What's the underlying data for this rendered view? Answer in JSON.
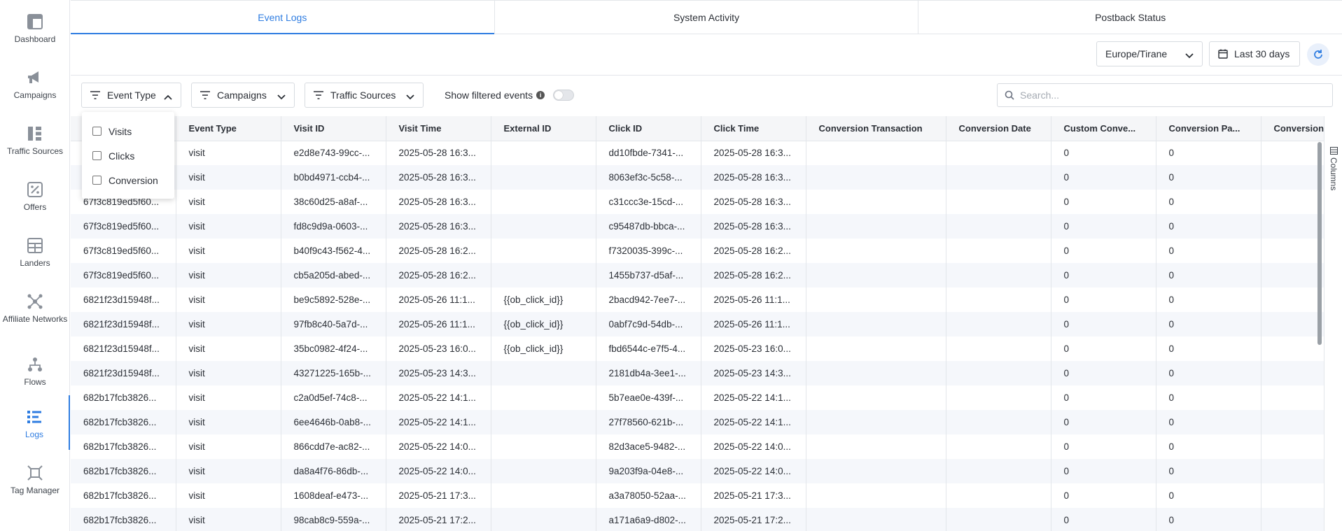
{
  "sidebar": {
    "items": [
      {
        "label": "Dashboard",
        "icon": "dashboard-icon"
      },
      {
        "label": "Campaigns",
        "icon": "megaphone-icon"
      },
      {
        "label": "Traffic Sources",
        "icon": "traffic-sources-icon"
      },
      {
        "label": "Offers",
        "icon": "percent-icon"
      },
      {
        "label": "Landers",
        "icon": "landers-icon"
      },
      {
        "label": "Affiliate Networks",
        "icon": "network-icon"
      },
      {
        "label": "Flows",
        "icon": "flows-icon"
      },
      {
        "label": "Logs",
        "icon": "logs-icon"
      },
      {
        "label": "Tag Manager",
        "icon": "tag-manager-icon"
      }
    ],
    "active": "Logs"
  },
  "tabs": [
    {
      "label": "Event Logs",
      "active": true
    },
    {
      "label": "System Activity",
      "active": false
    },
    {
      "label": "Postback Status",
      "active": false
    }
  ],
  "toolbar": {
    "timezone": "Europe/Tirane",
    "date_range": "Last 30 days"
  },
  "filters": {
    "event_type": "Event Type",
    "campaigns": "Campaigns",
    "traffic_sources": "Traffic Sources",
    "show_filtered": "Show filtered events",
    "search_placeholder": "Search..."
  },
  "dropdown": {
    "options": [
      "Visits",
      "Clicks",
      "Conversion"
    ]
  },
  "table": {
    "columns": [
      "",
      "Event Type",
      "Visit ID",
      "Visit Time",
      "External ID",
      "Click ID",
      "Click Time",
      "Conversion Transaction",
      "Conversion Date",
      "Custom Conve...",
      "Conversion Pa...",
      "Conversion"
    ],
    "rows": [
      [
        "",
        "visit",
        "e2d8e743-99cc-...",
        "2025-05-28 16:3...",
        "",
        "dd10fbde-7341-...",
        "2025-05-28 16:3...",
        "",
        "",
        "0",
        "0",
        ""
      ],
      [
        "",
        "visit",
        "b0bd4971-ccb4-...",
        "2025-05-28 16:3...",
        "",
        "8063ef3c-5c58-...",
        "2025-05-28 16:3...",
        "",
        "",
        "0",
        "0",
        ""
      ],
      [
        "67f3c819ed5f60...",
        "visit",
        "38c60d25-a8af-...",
        "2025-05-28 16:3...",
        "",
        "c31ccc3e-15cd-...",
        "2025-05-28 16:3...",
        "",
        "",
        "0",
        "0",
        ""
      ],
      [
        "67f3c819ed5f60...",
        "visit",
        "fd8c9d9a-0603-...",
        "2025-05-28 16:3...",
        "",
        "c95487db-bbca-...",
        "2025-05-28 16:3...",
        "",
        "",
        "0",
        "0",
        ""
      ],
      [
        "67f3c819ed5f60...",
        "visit",
        "b40f9c43-f562-4...",
        "2025-05-28 16:2...",
        "",
        "f7320035-399c-...",
        "2025-05-28 16:2...",
        "",
        "",
        "0",
        "0",
        ""
      ],
      [
        "67f3c819ed5f60...",
        "visit",
        "cb5a205d-abed-...",
        "2025-05-28 16:2...",
        "",
        "1455b737-d5af-...",
        "2025-05-28 16:2...",
        "",
        "",
        "0",
        "0",
        ""
      ],
      [
        "6821f23d15948f...",
        "visit",
        "be9c5892-528e-...",
        "2025-05-26 11:1...",
        "{{ob_click_id}}",
        "2bacd942-7ee7-...",
        "2025-05-26 11:1...",
        "",
        "",
        "0",
        "0",
        ""
      ],
      [
        "6821f23d15948f...",
        "visit",
        "97fb8c40-5a7d-...",
        "2025-05-26 11:1...",
        "{{ob_click_id}}",
        "0abf7c9d-54db-...",
        "2025-05-26 11:1...",
        "",
        "",
        "0",
        "0",
        ""
      ],
      [
        "6821f23d15948f...",
        "visit",
        "35bc0982-4f24-...",
        "2025-05-23 16:0...",
        "{{ob_click_id}}",
        "fbd6544c-e7f5-4...",
        "2025-05-23 16:0...",
        "",
        "",
        "0",
        "0",
        ""
      ],
      [
        "6821f23d15948f...",
        "visit",
        "43271225-165b-...",
        "2025-05-23 14:3...",
        "",
        "2181db4a-3ee1-...",
        "2025-05-23 14:3...",
        "",
        "",
        "0",
        "0",
        ""
      ],
      [
        "682b17fcb3826...",
        "visit",
        "c2a0d5ef-74c8-...",
        "2025-05-22 14:1...",
        "",
        "5b7eae0e-439f-...",
        "2025-05-22 14:1...",
        "",
        "",
        "0",
        "0",
        ""
      ],
      [
        "682b17fcb3826...",
        "visit",
        "6ee4646b-0ab8-...",
        "2025-05-22 14:1...",
        "",
        "27f78560-621b-...",
        "2025-05-22 14:1...",
        "",
        "",
        "0",
        "0",
        ""
      ],
      [
        "682b17fcb3826...",
        "visit",
        "866cdd7e-ac82-...",
        "2025-05-22 14:0...",
        "",
        "82d3ace5-9482-...",
        "2025-05-22 14:0...",
        "",
        "",
        "0",
        "0",
        ""
      ],
      [
        "682b17fcb3826...",
        "visit",
        "da8a4f76-86db-...",
        "2025-05-22 14:0...",
        "",
        "9a203f9a-04e8-...",
        "2025-05-22 14:0...",
        "",
        "",
        "0",
        "0",
        ""
      ],
      [
        "682b17fcb3826...",
        "visit",
        "1608deaf-e473-...",
        "2025-05-21 17:3...",
        "",
        "a3a78050-52aa-...",
        "2025-05-21 17:3...",
        "",
        "",
        "0",
        "0",
        ""
      ],
      [
        "682b17fcb3826...",
        "visit",
        "98cab8c9-559a-...",
        "2025-05-21 17:2...",
        "",
        "a171a6a9-d802-...",
        "2025-05-21 17:2...",
        "",
        "",
        "0",
        "0",
        ""
      ]
    ]
  },
  "columns_panel": {
    "label": "Columns"
  },
  "colors": {
    "accent": "#2f7de1",
    "row_alt": "#f5f7fb",
    "header_bg": "#f5f6f8",
    "border": "#e3e6ea"
  }
}
